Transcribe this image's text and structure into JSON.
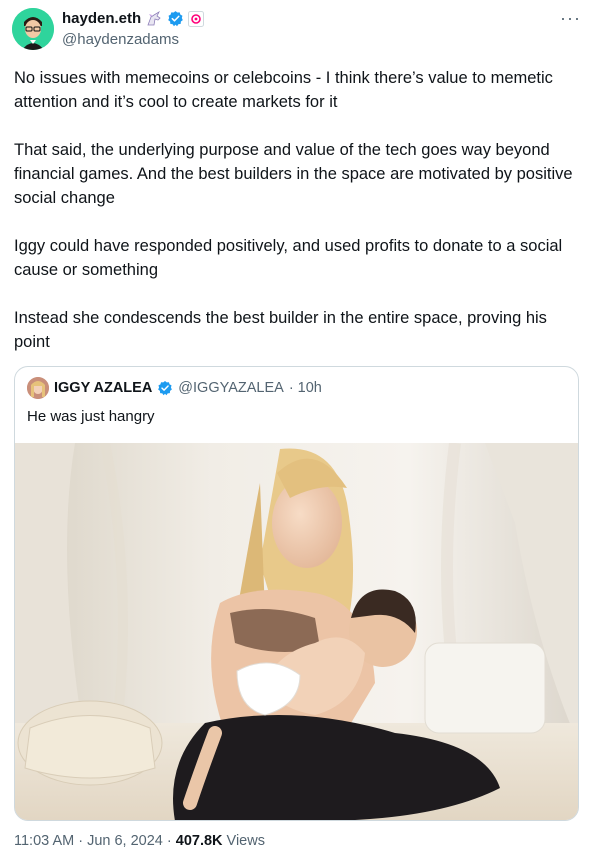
{
  "author": {
    "display_name": "hayden.eth",
    "handle": "@haydenzadams",
    "badges": [
      "unicorn-emoji-icon",
      "verified-badge-icon",
      "uniswap-pink-icon"
    ]
  },
  "more_label": "···",
  "tweet": {
    "paragraphs": [
      "No issues with memecoins or celebcoins - I think there’s value to memetic attention and it’s cool to create markets for it",
      "That said, the underlying purpose and value of the tech goes way beyond financial games. And the best builders in the space are motivated by positive social change",
      "Iggy could have responded positively, and used profits to donate to a social cause or something",
      "Instead she condescends the best builder in the entire space, proving his point"
    ]
  },
  "quote": {
    "display_name": "IGGY AZALEA",
    "handle": "@IGGYAZALEA",
    "time": "· 10h",
    "text": "He was just hangry"
  },
  "footer": {
    "time": "11:03 AM · Jun 6, 2024 · ",
    "views_count": "407.8K",
    "views_label": " Views"
  },
  "colors": {
    "verified": "#1d9bf0",
    "secondary_text": "#536471",
    "border": "#cfd9de"
  }
}
